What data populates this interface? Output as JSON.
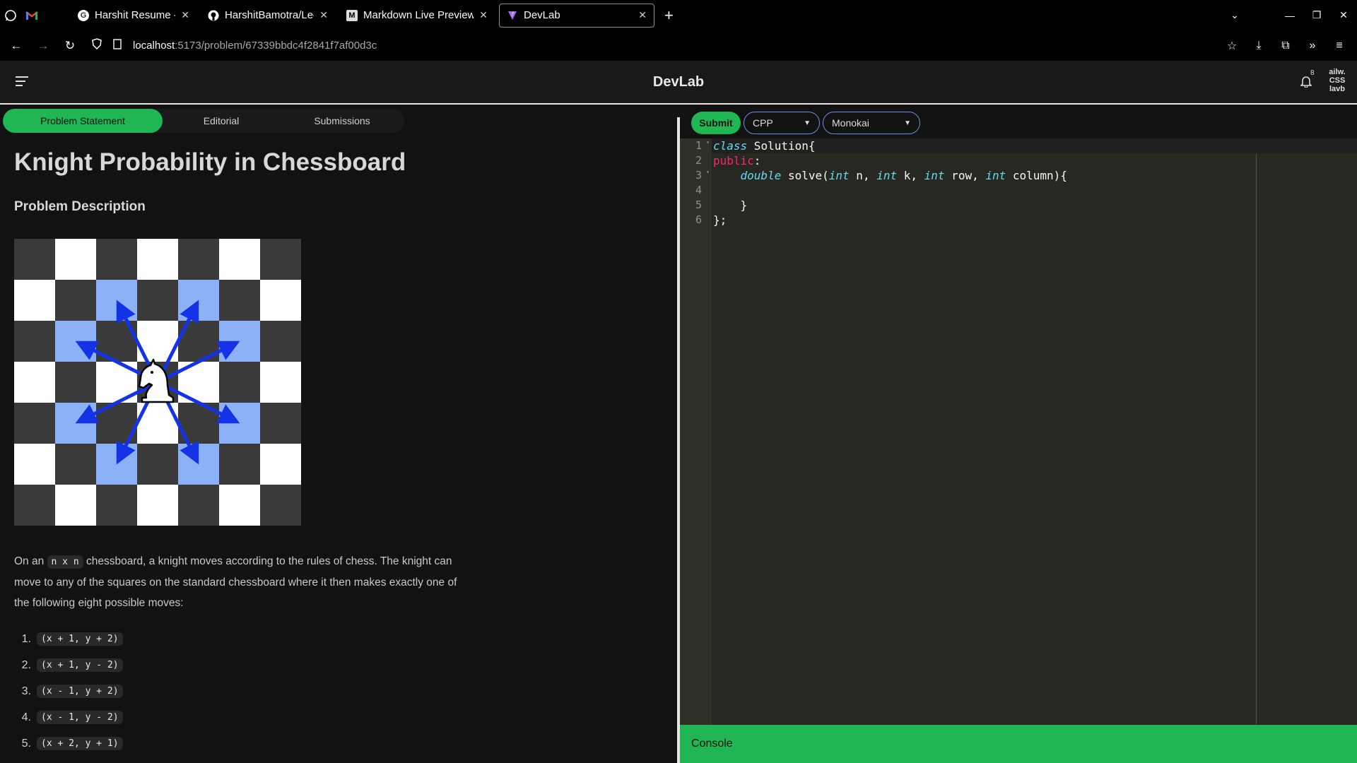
{
  "browser": {
    "tabs": [
      {
        "title": "Harshit Resume - Online",
        "favicon": "G"
      },
      {
        "title": "HarshitBamotra/Leetcod",
        "favicon": "github"
      },
      {
        "title": "Markdown Live Preview",
        "favicon": "M"
      },
      {
        "title": "DevLab",
        "favicon": "V"
      }
    ],
    "url_host": "localhost",
    "url_path": ":5173/problem/67339bbdc4f2841f7af00d3c"
  },
  "app": {
    "title": "DevLab",
    "notification_count": "8",
    "user_image_text": "ailw. CSS lavb"
  },
  "problem": {
    "tabs": [
      "Problem Statement",
      "Editorial",
      "Submissions"
    ],
    "title": "Knight Probability in Chessboard",
    "section": "Problem Description",
    "intro_a": "On an ",
    "intro_code": "n x n",
    "intro_b": " chessboard, a knight moves according to the rules of chess. The knight can move to any of the squares on the standard chessboard where it then makes exactly one of the following eight possible moves:",
    "moves": [
      {
        "num": "1.",
        "text": "(x + 1, y + 2)"
      },
      {
        "num": "2.",
        "text": "(x + 1, y - 2)"
      },
      {
        "num": "3.",
        "text": "(x - 1, y + 2)"
      },
      {
        "num": "4.",
        "text": "(x - 1, y - 2)"
      },
      {
        "num": "5.",
        "text": "(x + 2, y + 1)"
      }
    ]
  },
  "editor": {
    "submit_label": "Submit",
    "language": "CPP",
    "theme": "Monokai",
    "line_numbers": [
      "1",
      "2",
      "3",
      "4",
      "5",
      "6"
    ],
    "console_label": "Console"
  },
  "colors": {
    "accent": "#1fb653",
    "editor_bg": "#272822",
    "arrow": "#1432e6",
    "highlight": "#8db1f7"
  }
}
